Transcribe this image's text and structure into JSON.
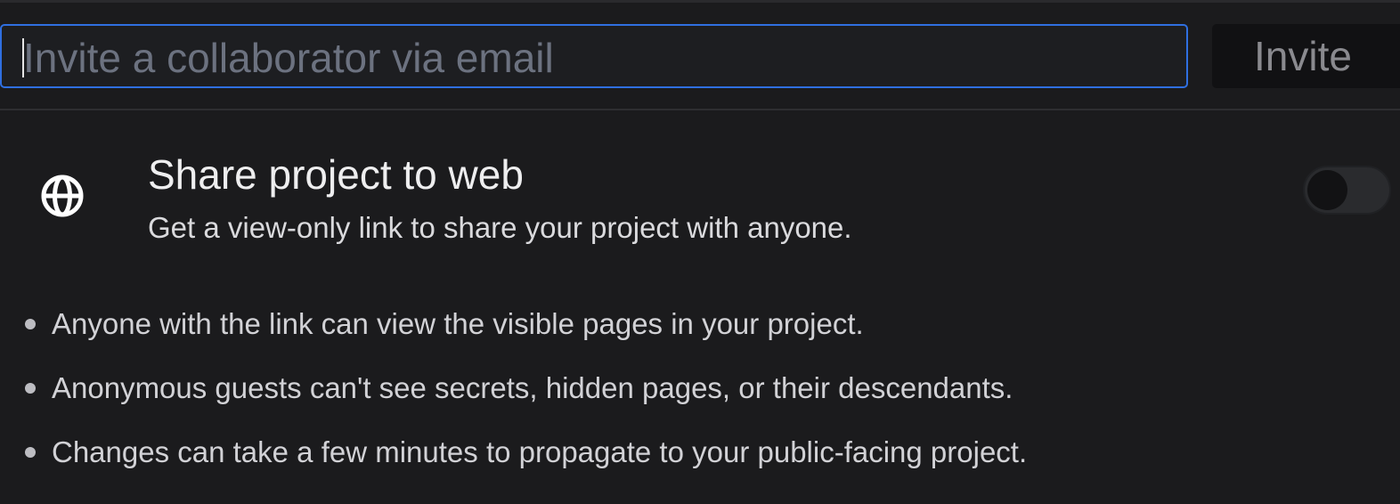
{
  "invite": {
    "placeholder": "Invite a collaborator via email",
    "value": "",
    "button_label": "Invite"
  },
  "share": {
    "icon": "globe-icon",
    "title": "Share project to web",
    "subtitle": "Get a view-only link to share your project with anyone.",
    "enabled": false
  },
  "notes": [
    "Anyone with the link can view the visible pages in your project.",
    "Anonymous guests can't see secrets, hidden pages, or their descendants.",
    "Changes can take a few minutes to propagate to your public-facing project."
  ],
  "colors": {
    "background": "#1b1b1d",
    "focus_border": "#2f6fe0",
    "placeholder": "#6c7280",
    "toggle_off": "#2a2b2e"
  }
}
